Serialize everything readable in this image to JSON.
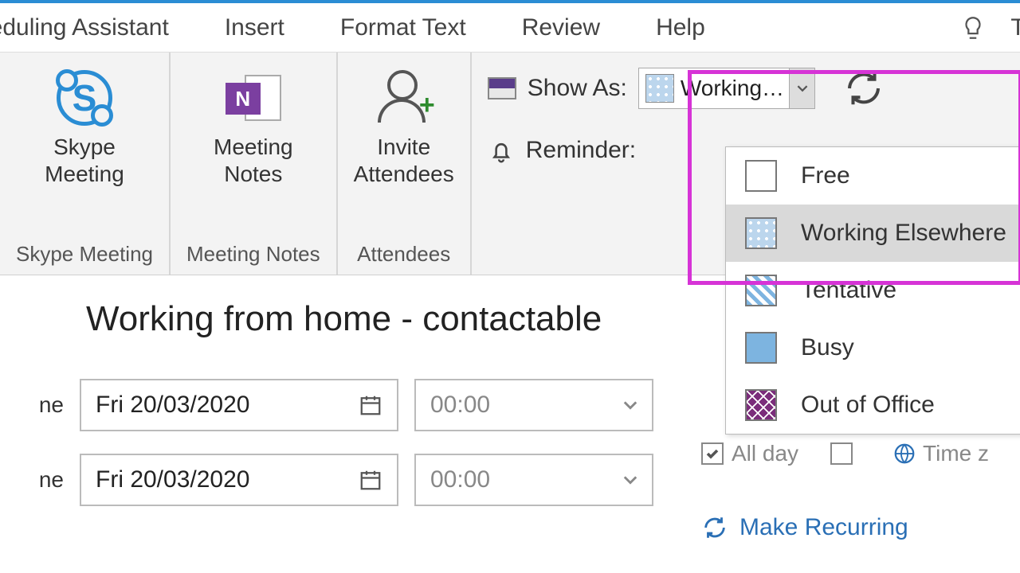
{
  "tabs": {
    "scheduling": "heduling Assistant",
    "insert": "Insert",
    "format": "Format Text",
    "review": "Review",
    "help": "Help",
    "tell": "Te"
  },
  "ribbon": {
    "skype": {
      "label": "Skype\nMeeting",
      "group": "Skype Meeting"
    },
    "notes": {
      "label": "Meeting\nNotes",
      "group": "Meeting Notes",
      "badge": "N"
    },
    "invite": {
      "label": "Invite\nAttendees",
      "group": "Attendees"
    },
    "showas_label": "Show As:",
    "showas_value": "Working…",
    "reminder_label": "Reminder:"
  },
  "dropdown": {
    "free": "Free",
    "working_elsewhere": "Working Elsewhere",
    "tentative": "Tentative",
    "busy": "Busy",
    "ooo": "Out of Office"
  },
  "form": {
    "subject": "Working from home - contactable",
    "start_label": "ne",
    "end_label": "ne",
    "start_date": "Fri 20/03/2020",
    "end_date": "Fri 20/03/2020",
    "start_time": "00:00",
    "end_time": "00:00",
    "allday": "All day",
    "timez": "Time z",
    "make_recurring": "Make Recurring"
  },
  "skype_s": "S"
}
